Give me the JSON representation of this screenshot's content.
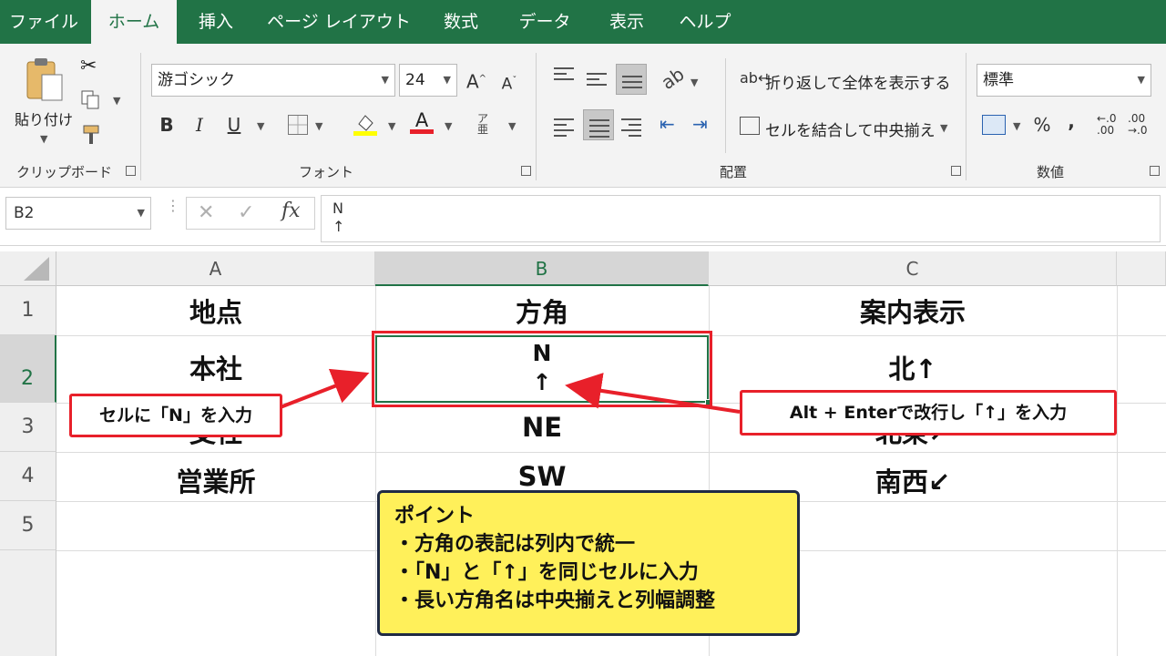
{
  "tabs": [
    "ファイル",
    "ホーム",
    "挿入",
    "ページ レイアウト",
    "数式",
    "データ",
    "表示",
    "ヘルプ"
  ],
  "active_tab": "ホーム",
  "ribbon": {
    "clipboard": {
      "paste_label": "貼り付け",
      "group_label": "クリップボード"
    },
    "font": {
      "font_name": "游ゴシック",
      "font_size": "24",
      "grow_label": "A",
      "shrink_label": "A",
      "bold": "B",
      "italic": "I",
      "underline": "U",
      "font_color_label": "A",
      "group_label": "フォント"
    },
    "alignment": {
      "wrap_text_label": "折り返して全体を表示する",
      "merge_center_label": "セルを結合して中央揃え",
      "group_label": "配置"
    },
    "number": {
      "format_value": "標準",
      "percent": "%",
      "comma": ",",
      "group_label": "数値"
    }
  },
  "formula_bar": {
    "name_box": "B2",
    "fx_label": "fx",
    "formula_text": "N\n↑"
  },
  "columns": [
    "A",
    "B",
    "C"
  ],
  "rows": [
    "1",
    "2",
    "3",
    "4",
    "5"
  ],
  "cells": {
    "a1": "地点",
    "b1": "方角",
    "c1": "案内表示",
    "a2": "本社",
    "b2": "N\n↑",
    "c2": "北↑",
    "a3": "支社",
    "b3": "NE",
    "c3": "北東↗",
    "a4": "営業所",
    "b4": "SW",
    "c4": "南西↙"
  },
  "callouts": {
    "left": "セルに「N」を入力",
    "right": "Alt + Enterで改行し「↑」を入力"
  },
  "point_box": {
    "title": "ポイント",
    "items": [
      "・方角の表記は列内で統一",
      "・「N」と「↑」を同じセルに入力",
      "・長い方角名は中央揃えと列幅調整"
    ]
  },
  "colors": {
    "excel_green": "#217346",
    "callout_red": "#e8202a",
    "note_yellow": "#fff05a"
  }
}
